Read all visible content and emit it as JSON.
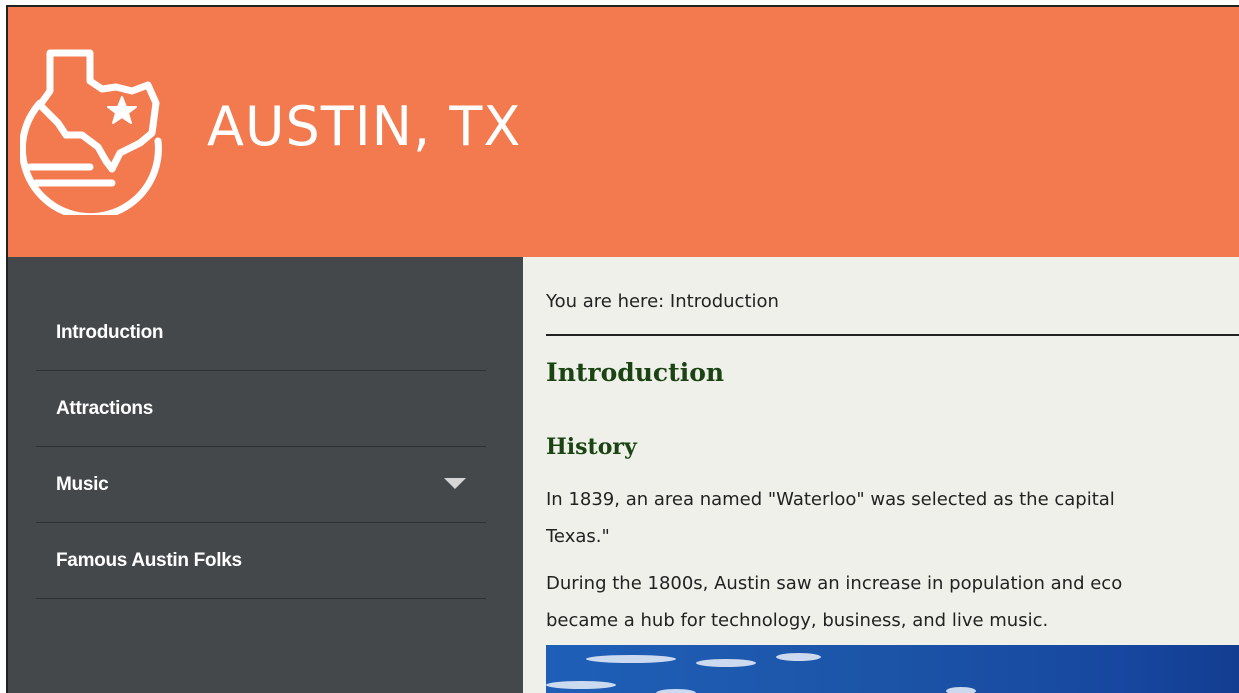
{
  "header": {
    "title": "AUSTIN, TX",
    "logo_icon": "texas-map-star-icon",
    "background_color": "#f37a4f"
  },
  "sidebar": {
    "background_color": "#45484b",
    "items": [
      {
        "label": "Introduction",
        "has_submenu": false
      },
      {
        "label": "Attractions",
        "has_submenu": false
      },
      {
        "label": "Music",
        "has_submenu": true,
        "icon": "caret-down-icon"
      },
      {
        "label": "Famous Austin Folks",
        "has_submenu": false
      }
    ]
  },
  "main": {
    "breadcrumb": "You are here: Introduction",
    "page_title": "Introduction",
    "section_title": "History",
    "heading_color": "#1b4413",
    "paragraphs": [
      {
        "lines": [
          "In 1839, an area named \"Waterloo\" was selected as the capital",
          "Texas.\""
        ]
      },
      {
        "lines": [
          "During the 1800s, Austin saw an increase in population and eco",
          "became a hub for technology, business, and live music."
        ]
      }
    ],
    "image_description_icon": "city-sky-photo"
  }
}
